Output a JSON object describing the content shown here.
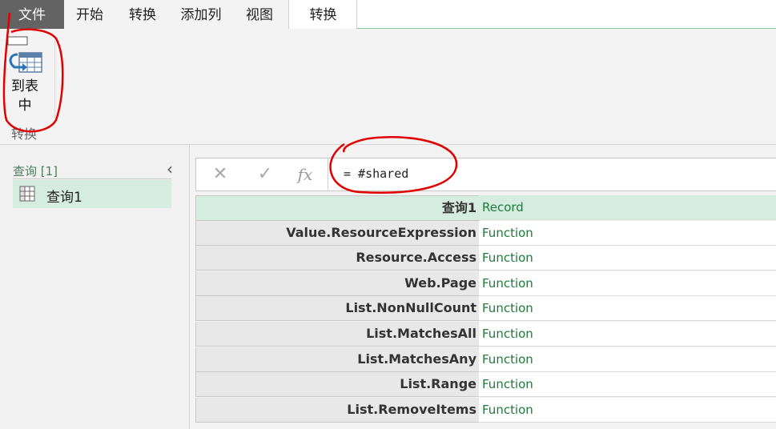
{
  "ribbon": {
    "tabs": {
      "file": "文件",
      "home": "开始",
      "transform": "转换",
      "add_column": "添加列",
      "view": "视图",
      "active": "转换"
    },
    "to_table_label_1": "到表",
    "to_table_label_2": "中",
    "group_label": "转换"
  },
  "queries": {
    "header": "查询 [1]",
    "items": [
      "查询1"
    ]
  },
  "formula_bar": {
    "formula": "= #shared"
  },
  "grid": {
    "header": {
      "name": "查询1",
      "value": "Record"
    },
    "rows": [
      {
        "name": "Value.ResourceExpression",
        "value": "Function"
      },
      {
        "name": "Resource.Access",
        "value": "Function"
      },
      {
        "name": "Web.Page",
        "value": "Function"
      },
      {
        "name": "List.NonNullCount",
        "value": "Function"
      },
      {
        "name": "List.MatchesAll",
        "value": "Function"
      },
      {
        "name": "List.MatchesAny",
        "value": "Function"
      },
      {
        "name": "List.Range",
        "value": "Function"
      },
      {
        "name": "List.RemoveItems",
        "value": "Function"
      }
    ]
  },
  "colors": {
    "accent_green": "#1f7a3a",
    "selection": "#d5ece0",
    "annotation": "#e00000"
  }
}
